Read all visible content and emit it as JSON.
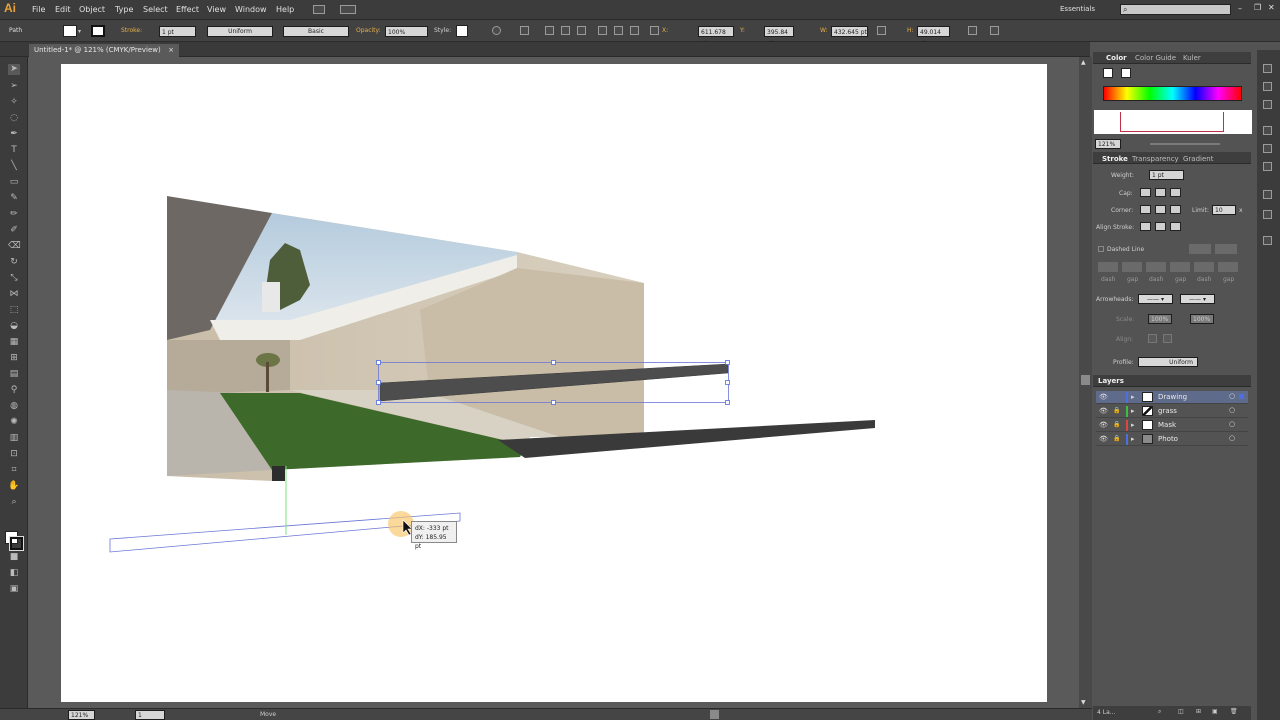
{
  "app": {
    "logo": "Ai",
    "workspace": "Essentials",
    "search_placeholder": ""
  },
  "menu": [
    "File",
    "Edit",
    "Object",
    "Type",
    "Select",
    "Effect",
    "View",
    "Window",
    "Help"
  ],
  "control": {
    "selection_type": "Path",
    "stroke_label": "Stroke:",
    "stroke_weight": "1 pt",
    "variable_width": "Uniform",
    "brush": "Basic",
    "opacity_label": "Opacity:",
    "opacity": "100%",
    "style_label": "Style:",
    "x": "611.678 pt",
    "y": "395.84 pt",
    "w": "432.645 pt",
    "h": "49.014 pt"
  },
  "document": {
    "tab_title": "Untitled-1* @ 121% (CMYK/Preview)",
    "close": "×"
  },
  "tooltip": {
    "dx": "dX: -333 pt",
    "dy": "dY: 185.95 pt"
  },
  "status": {
    "zoom": "121%",
    "artboard": "1",
    "action": "Move"
  },
  "color_panel": {
    "tabs": [
      "Color",
      "Color Guide",
      "Kuler"
    ],
    "zoom": "121%"
  },
  "stroke_panel": {
    "tabs": [
      "Stroke",
      "Transparency",
      "Gradient"
    ],
    "weight_label": "Weight:",
    "weight": "1 pt",
    "cap_label": "Cap:",
    "corner_label": "Corner:",
    "limit_label": "Limit:",
    "limit": "10",
    "limit_unit": "x",
    "align_label": "Align Stroke:",
    "dashed_label": "Dashed Line",
    "dash_labels": [
      "dash",
      "gap",
      "dash",
      "gap",
      "dash",
      "gap"
    ],
    "arrowheads_label": "Arrowheads:",
    "scale_label": "Scale:",
    "scale1": "100%",
    "scale2": "100%",
    "align2_label": "Align:",
    "profile_label": "Profile:",
    "profile": "Uniform"
  },
  "layers_panel": {
    "title": "Layers",
    "layers": [
      {
        "name": "Drawing",
        "color": "#4f6ee0",
        "selected": true
      },
      {
        "name": "grass",
        "color": "#3fbf3f",
        "selected": false
      },
      {
        "name": "Mask",
        "color": "#e04545",
        "selected": false
      },
      {
        "name": "Photo",
        "color": "#4f6ee0",
        "selected": false
      }
    ],
    "footer": "4 La..."
  },
  "icons": {
    "toolbox": [
      "selection-icon",
      "direct-selection-icon",
      "magic-wand-icon",
      "lasso-icon",
      "pen-icon",
      "type-icon",
      "line-icon",
      "rectangle-icon",
      "paintbrush-icon",
      "pencil-icon",
      "blob-brush-icon",
      "eraser-icon",
      "rotate-icon",
      "scale-icon",
      "width-icon",
      "free-transform-icon",
      "shape-builder-icon",
      "perspective-grid-icon",
      "mesh-icon",
      "gradient-icon",
      "eyedropper-icon",
      "blend-icon",
      "symbol-sprayer-icon",
      "column-graph-icon",
      "artboard-icon",
      "slice-icon",
      "hand-icon",
      "zoom-icon"
    ]
  }
}
